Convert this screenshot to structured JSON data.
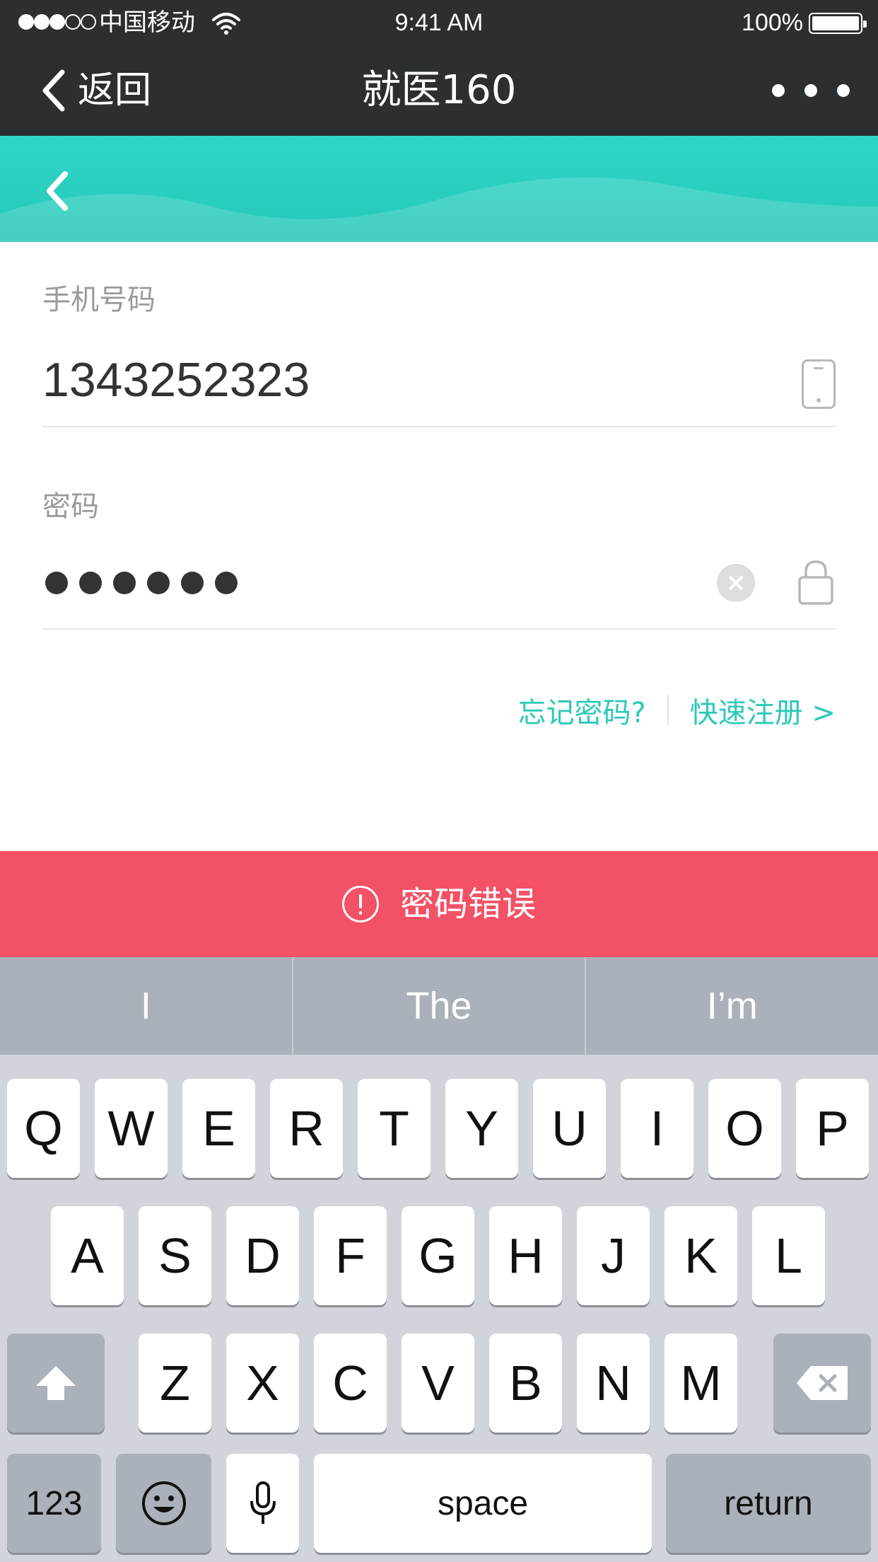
{
  "status_bar": {
    "carrier": "中国移动",
    "time": "9:41 AM",
    "battery": "100%"
  },
  "nav": {
    "back_label": "返回",
    "title": "就医160"
  },
  "form": {
    "phone_label": "手机号码",
    "phone_value": "1343252323",
    "password_label": "密码",
    "password_length": 6
  },
  "links": {
    "forgot": "忘记密码?",
    "register": "快速注册 >"
  },
  "error": {
    "message": "密码错误"
  },
  "keyboard": {
    "suggestions": [
      "I",
      "The",
      "I’m"
    ],
    "row1": [
      "Q",
      "W",
      "E",
      "R",
      "T",
      "Y",
      "U",
      "I",
      "O",
      "P"
    ],
    "row2": [
      "A",
      "S",
      "D",
      "F",
      "G",
      "H",
      "J",
      "K",
      "L"
    ],
    "row3": [
      "Z",
      "X",
      "C",
      "V",
      "B",
      "N",
      "M"
    ],
    "numbers_key": "123",
    "space_key": "space",
    "return_key": "return"
  },
  "colors": {
    "accent": "#2cc9b8",
    "error": "#f35166",
    "nav_bg": "#2b2f31"
  }
}
